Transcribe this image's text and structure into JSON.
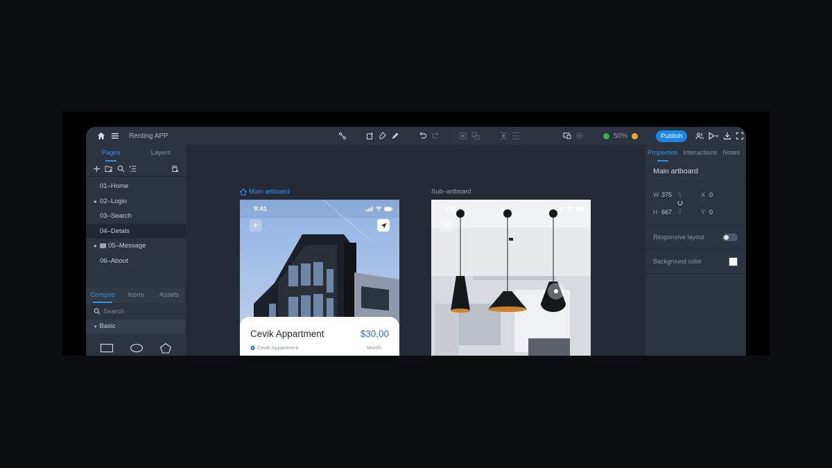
{
  "app": {
    "title": "Renting APP"
  },
  "toolbar": {
    "zoom": "50%",
    "publish_label": "Publish"
  },
  "left_panel": {
    "tabs": [
      "Pages",
      "Layers"
    ],
    "pages": [
      "01–Home",
      "02–Login",
      "03–Search",
      "04–Detals",
      "05–Message",
      "06–About"
    ],
    "compos_tabs": [
      "Compos",
      "Icons",
      "Assets"
    ],
    "search_placeholder": "Search",
    "group_label": "Basic"
  },
  "canvas": {
    "main_artboard_label": "Main artboard",
    "sub_artboard_label": "Sub–artboard",
    "status_time": "9:41",
    "card": {
      "name": "Cevik Appartment",
      "price": "$30,00",
      "subtitle": "Cevik Appartment",
      "unit": "Month"
    }
  },
  "right_panel": {
    "tabs": [
      "Properties",
      "Interactions",
      "Notes"
    ],
    "title": "Main artboard",
    "width_label": "W",
    "width_value": "375",
    "height_label": "H",
    "height_value": "667",
    "x_label": "X",
    "x_value": "0",
    "y_label": "Y",
    "y_value": "0",
    "responsive_label": "Responsive layout",
    "responsive_on": false,
    "background_label": "Background color",
    "background_color": "#ffffff"
  },
  "colors": {
    "accent": "#1a86e8",
    "panel": "#2d3441",
    "canvas": "#252b36"
  }
}
